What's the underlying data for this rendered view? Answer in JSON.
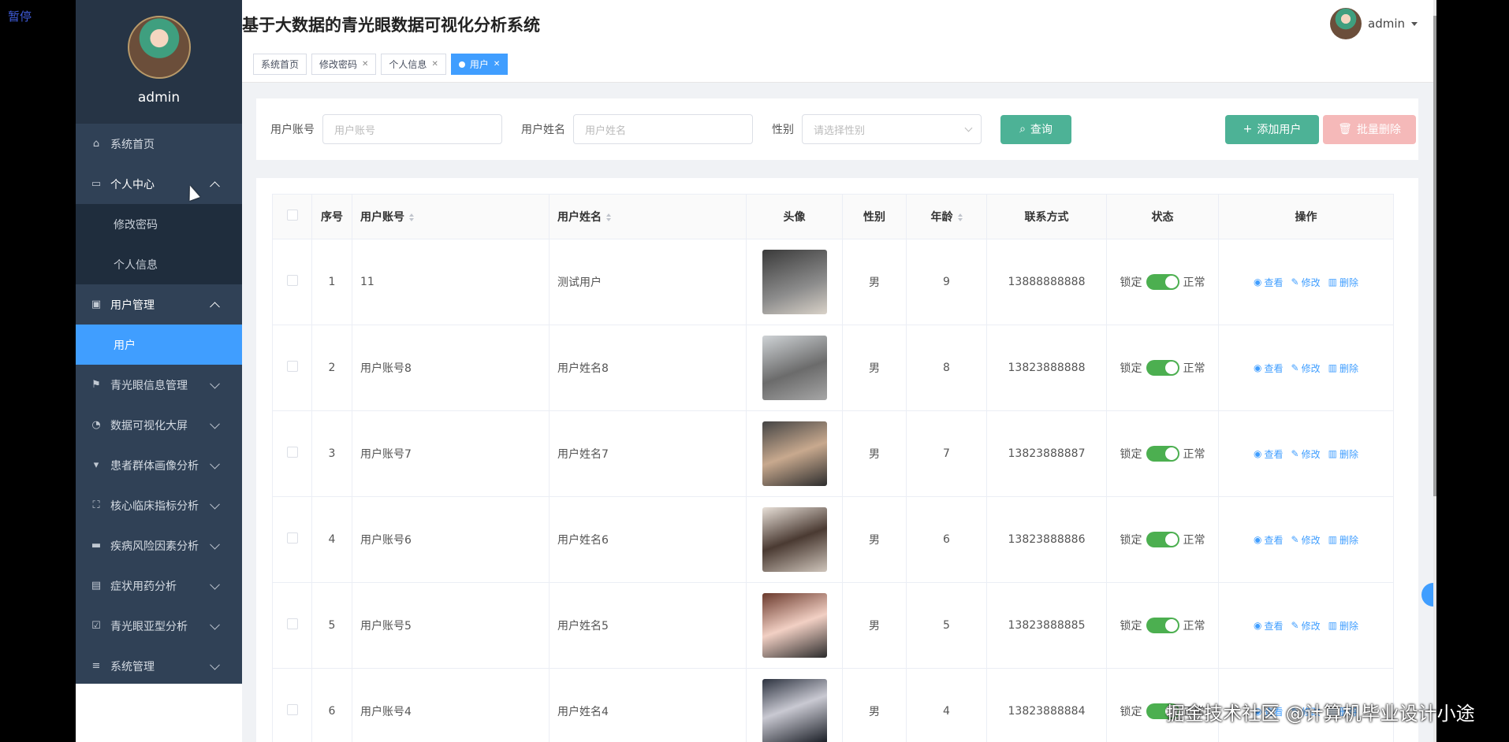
{
  "overlay": {
    "paused": "暂停",
    "watermark": "掘金技术社区 @计算机毕业设计小途"
  },
  "sidebar": {
    "username": "admin",
    "items": [
      {
        "label": "系统首页",
        "icon": "home-icon"
      },
      {
        "label": "个人中心",
        "icon": "card-icon"
      },
      {
        "label": "修改密码"
      },
      {
        "label": "个人信息"
      },
      {
        "label": "用户管理",
        "icon": "clipboard-icon"
      },
      {
        "label": "用户"
      },
      {
        "label": "青光眼信息管理",
        "icon": "flag-icon"
      },
      {
        "label": "数据可视化大屏",
        "icon": "compass-icon"
      },
      {
        "label": "患者群体画像分析",
        "icon": "brush-icon"
      },
      {
        "label": "核心临床指标分析",
        "icon": "fullscreen-icon"
      },
      {
        "label": "疾病风险因素分析",
        "icon": "monitor-icon"
      },
      {
        "label": "症状用药分析",
        "icon": "list-icon"
      },
      {
        "label": "青光眼亚型分析",
        "icon": "check-clipboard-icon"
      },
      {
        "label": "系统管理",
        "icon": "menu-icon"
      }
    ]
  },
  "header": {
    "title": "基于大数据的青光眼数据可视化分析系统",
    "user": "admin",
    "tabs": [
      {
        "label": "系统首页"
      },
      {
        "label": "修改密码"
      },
      {
        "label": "个人信息"
      },
      {
        "label": "用户"
      }
    ]
  },
  "search": {
    "account_label": "用户账号",
    "account_placeholder": "用户账号",
    "name_label": "用户姓名",
    "name_placeholder": "用户姓名",
    "gender_label": "性别",
    "gender_placeholder": "请选择性别",
    "query_label": "查询",
    "add_label": "添加用户",
    "batch_delete_label": "批量删除"
  },
  "table": {
    "columns": [
      "序号",
      "用户账号",
      "用户姓名",
      "头像",
      "性别",
      "年龄",
      "联系方式",
      "状态",
      "操作"
    ],
    "lock_label": "锁定",
    "normal_label": "正常",
    "ops": {
      "view": "查看",
      "edit": "修改",
      "delete": "删除"
    },
    "rows": [
      {
        "index": "1",
        "account": "11",
        "name": "测试用户",
        "gender": "男",
        "age": "9",
        "phone": "13888888888"
      },
      {
        "index": "2",
        "account": "用户账号8",
        "name": "用户姓名8",
        "gender": "男",
        "age": "8",
        "phone": "13823888888"
      },
      {
        "index": "3",
        "account": "用户账号7",
        "name": "用户姓名7",
        "gender": "男",
        "age": "7",
        "phone": "13823888887"
      },
      {
        "index": "4",
        "account": "用户账号6",
        "name": "用户姓名6",
        "gender": "男",
        "age": "6",
        "phone": "13823888886"
      },
      {
        "index": "5",
        "account": "用户账号5",
        "name": "用户姓名5",
        "gender": "男",
        "age": "5",
        "phone": "13823888885"
      },
      {
        "index": "6",
        "account": "用户账号4",
        "name": "用户姓名4",
        "gender": "男",
        "age": "4",
        "phone": "13823888884"
      }
    ]
  }
}
